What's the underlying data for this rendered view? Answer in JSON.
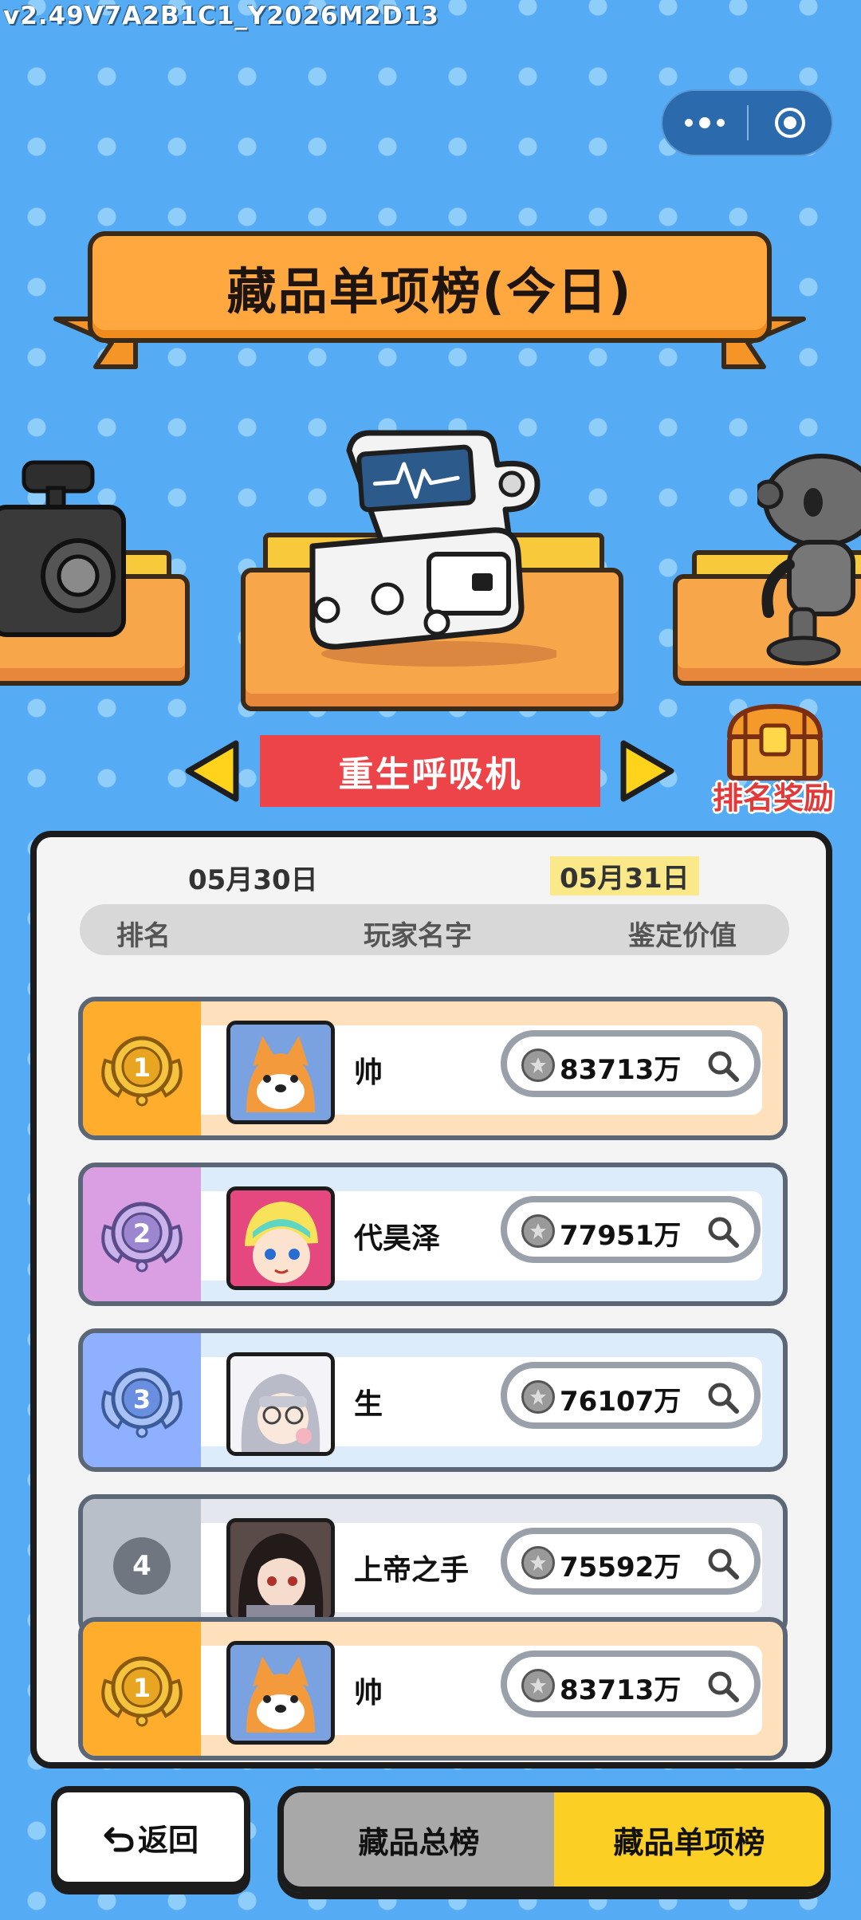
{
  "version": "v2.49V7A2B1C1_Y2026M2D13",
  "title": "藏品单项榜(今日)",
  "item": {
    "name": "重生呼吸机",
    "reward_label": "排名奖励"
  },
  "dates": {
    "previous": "05月30日",
    "current": "05月31日"
  },
  "columns": {
    "rank": "排名",
    "player": "玩家名字",
    "value": "鉴定价值"
  },
  "rows": [
    {
      "rank": "1",
      "name": "帅",
      "value": "83713万"
    },
    {
      "rank": "2",
      "name": "代昊泽",
      "value": "77951万"
    },
    {
      "rank": "3",
      "name": "生",
      "value": "76107万"
    },
    {
      "rank": "4",
      "name": "上帝之手",
      "value": "75592万"
    }
  ],
  "my_row": {
    "rank": "1",
    "name": "帅",
    "value": "83713万"
  },
  "bottom": {
    "back": "返回",
    "tab_total": "藏品总榜",
    "tab_single": "藏品单项榜"
  },
  "colors": {
    "background": "#55acf4",
    "banner": "#ffa840",
    "item_name_bg": "#ec4448",
    "active_tab": "#fccf24",
    "inactive_tab": "#a8a8a8"
  }
}
